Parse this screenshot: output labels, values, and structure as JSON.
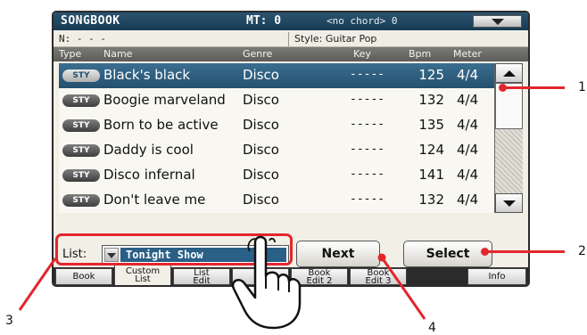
{
  "titlebar": {
    "title": "SONGBOOK",
    "mt": "MT: 0",
    "chord": "<no chord> 0"
  },
  "info": {
    "n": "N: - - -",
    "style": "Style: Guitar Pop"
  },
  "columns": {
    "type": "Type",
    "name": "Name",
    "genre": "Genre",
    "key": "Key",
    "bpm": "Bpm",
    "meter": "Meter"
  },
  "rows": [
    {
      "badge": "STY",
      "name": "Black's black",
      "genre": "Disco",
      "key": "-----",
      "bpm": "125",
      "meter": "4/4",
      "selected": true
    },
    {
      "badge": "STY",
      "name": "Boogie marveland",
      "genre": "Disco",
      "key": "-----",
      "bpm": "132",
      "meter": "4/4"
    },
    {
      "badge": "STY",
      "name": "Born to be active",
      "genre": "Disco",
      "key": "-----",
      "bpm": "135",
      "meter": "4/4"
    },
    {
      "badge": "STY",
      "name": "Daddy is cool",
      "genre": "Disco",
      "key": "-----",
      "bpm": "124",
      "meter": "4/4"
    },
    {
      "badge": "STY",
      "name": "Disco infernal",
      "genre": "Disco",
      "key": "-----",
      "bpm": "141",
      "meter": "4/4"
    },
    {
      "badge": "STY",
      "name": "Don't leave me",
      "genre": "Disco",
      "key": "-----",
      "bpm": "132",
      "meter": "4/4"
    }
  ],
  "controls": {
    "list_label": "List:",
    "list_value": "Tonight Show",
    "next_label": "Next",
    "select_label": "Select"
  },
  "tabs": [
    {
      "label": "Book"
    },
    {
      "label": "Custom\nList",
      "active": true
    },
    {
      "label": "List\nEdit"
    },
    {
      "label": ""
    },
    {
      "label": "Book\nEdit 2"
    },
    {
      "label": "Book\nEdit 3"
    },
    {
      "label": ""
    },
    {
      "label": "Info"
    }
  ],
  "callouts": {
    "c1": "1",
    "c2": "2",
    "c3": "3",
    "c4": "4"
  },
  "colors": {
    "accent": "#e3262d",
    "selection": "#2a5f86",
    "titlebar": "#1f4a66"
  },
  "icons": {
    "menu": "triangle-down-icon",
    "pointer": "pointing-hand-icon"
  }
}
